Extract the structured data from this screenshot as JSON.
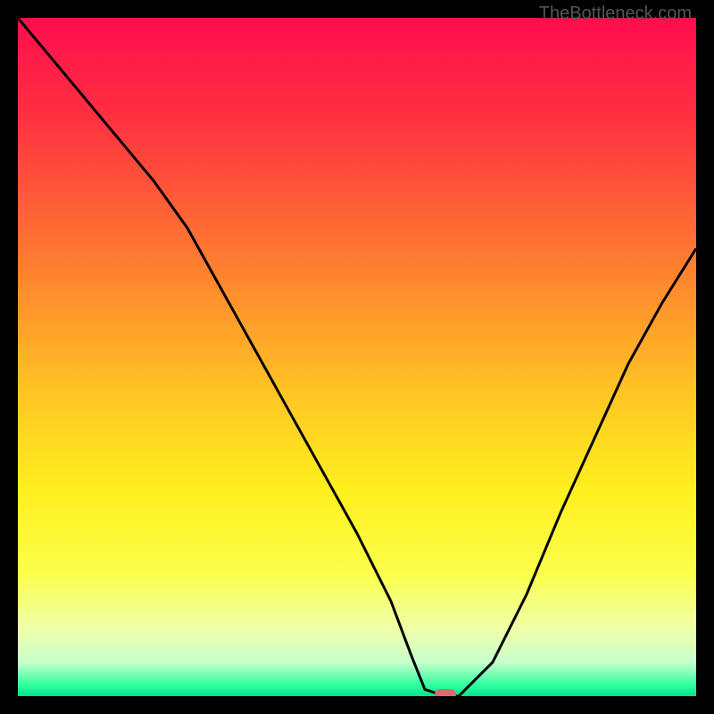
{
  "watermark": "TheBottleneck.com",
  "chart_data": {
    "type": "line",
    "title": "",
    "xlabel": "",
    "ylabel": "",
    "xlim": [
      0,
      100
    ],
    "ylim": [
      0,
      100
    ],
    "x": [
      0,
      5,
      10,
      15,
      20,
      25,
      30,
      35,
      40,
      45,
      50,
      55,
      58,
      60,
      63,
      65,
      70,
      75,
      80,
      85,
      90,
      95,
      100
    ],
    "values": [
      100,
      94,
      88,
      82,
      76,
      69,
      60,
      51,
      42,
      33,
      24,
      14,
      6,
      1,
      0,
      0,
      5,
      15,
      27,
      38,
      49,
      58,
      66
    ],
    "marker": {
      "x": 63,
      "y": 0
    },
    "gradient_stops": [
      {
        "offset": 0.0,
        "color": "#ff0d4d"
      },
      {
        "offset": 0.15,
        "color": "#ff3140"
      },
      {
        "offset": 0.35,
        "color": "#ff7931"
      },
      {
        "offset": 0.55,
        "color": "#ffc423"
      },
      {
        "offset": 0.7,
        "color": "#fff01f"
      },
      {
        "offset": 0.82,
        "color": "#fbff4d"
      },
      {
        "offset": 0.9,
        "color": "#f0ffa8"
      },
      {
        "offset": 0.95,
        "color": "#c8ffcc"
      },
      {
        "offset": 0.985,
        "color": "#2aff9c"
      },
      {
        "offset": 1.0,
        "color": "#00e38f"
      }
    ]
  }
}
